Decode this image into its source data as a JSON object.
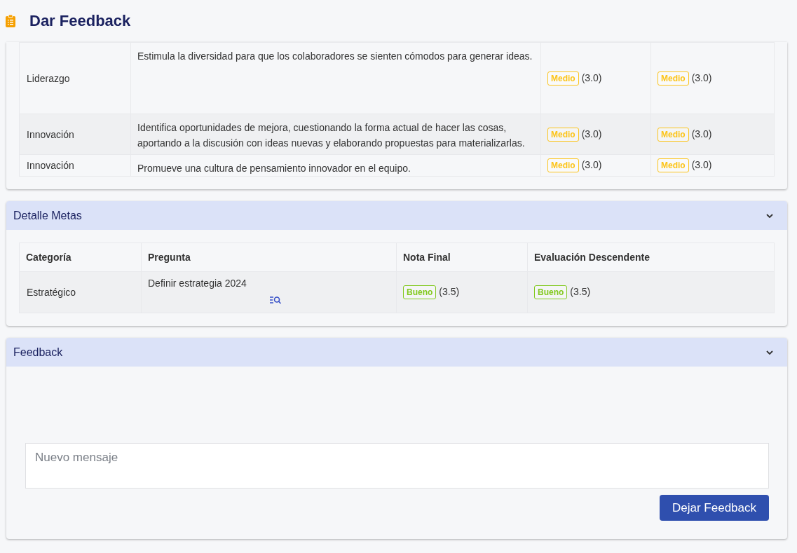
{
  "page": {
    "title": "Dar Feedback"
  },
  "competencies": {
    "rows": [
      {
        "category": "Liderazgo",
        "question": "Estimula la diversidad para que los colaboradores se sienten cómodos para generar ideas.",
        "scores": [
          {
            "badge": "Medio",
            "color": "#fcc419",
            "value": "(3.0)"
          },
          {
            "badge": "Medio",
            "color": "#fcc419",
            "value": "(3.0)"
          }
        ]
      },
      {
        "category": "Innovación",
        "question": "Identifica oportunidades de mejora, cuestionando la forma actual de hacer las cosas, aportando a la discusión con ideas nuevas y elaborando propuestas para materializarlas.",
        "scores": [
          {
            "badge": "Medio",
            "color": "#fcc419",
            "value": "(3.0)"
          },
          {
            "badge": "Medio",
            "color": "#fcc419",
            "value": "(3.0)"
          }
        ]
      },
      {
        "category": "Innovación",
        "question": "Promueve una cultura de pensamiento innovador en el equipo.",
        "scores": [
          {
            "badge": "Medio",
            "color": "#fcc419",
            "value": "(3.0)"
          },
          {
            "badge": "Medio",
            "color": "#fcc419",
            "value": "(3.0)"
          }
        ]
      }
    ]
  },
  "goals": {
    "title": "Detalle Metas",
    "columns": [
      "Categoría",
      "Pregunta",
      "Nota Final",
      "Evaluación Descendente"
    ],
    "rows": [
      {
        "category": "Estratégico",
        "question": "Definir estrategia 2024",
        "scores": [
          {
            "badge": "Bueno",
            "color": "#82c91e",
            "value": "(3.5)"
          },
          {
            "badge": "Bueno",
            "color": "#82c91e",
            "value": "(3.5)"
          }
        ]
      }
    ]
  },
  "feedback": {
    "title": "Feedback",
    "placeholder": "Nuevo mensaje",
    "button": "Dejar Feedback"
  }
}
